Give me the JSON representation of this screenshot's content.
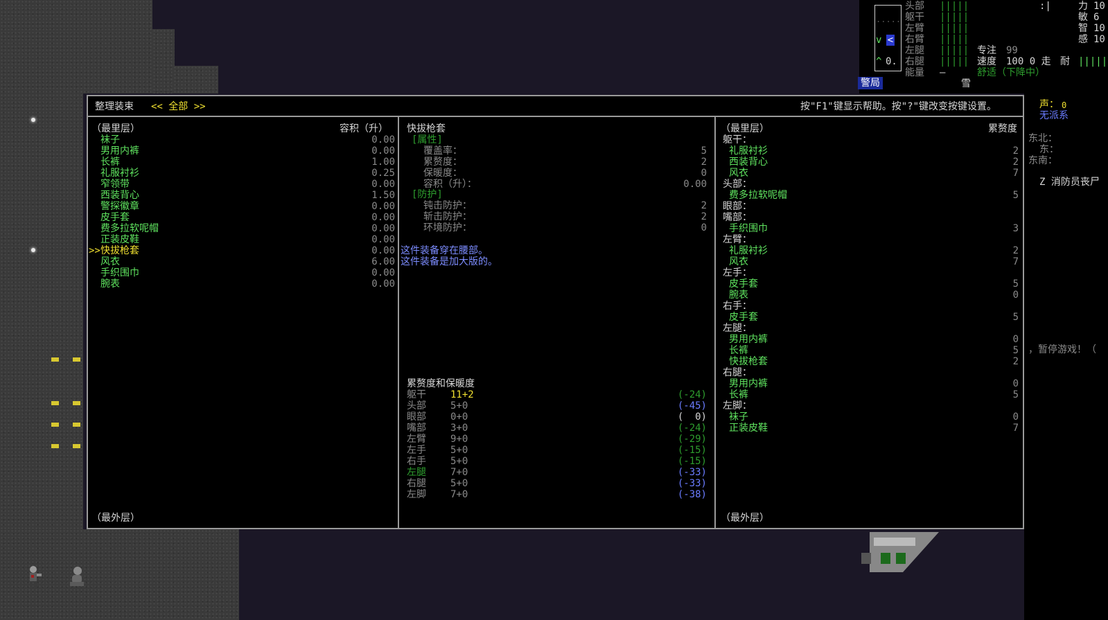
{
  "header": {
    "title": "整理装束",
    "filter": "<< 全部 >>",
    "help": "按\"F1\"键显示帮助。按\"?\"键改变按键设置。"
  },
  "left": {
    "innermost": "（最里层）",
    "outermost": "（最外层）",
    "vol_header": "容积（升）",
    "cursor": ">>",
    "items": [
      {
        "name": "袜子",
        "vol": "0.00"
      },
      {
        "name": "男用内裤",
        "vol": "0.00"
      },
      {
        "name": "长裤",
        "vol": "1.00"
      },
      {
        "name": "礼服衬衫",
        "vol": "0.25"
      },
      {
        "name": "窄领带",
        "vol": "0.00"
      },
      {
        "name": "西装背心",
        "vol": "1.50"
      },
      {
        "name": "警探徽章",
        "vol": "0.00"
      },
      {
        "name": "皮手套",
        "vol": "0.00"
      },
      {
        "name": "费多拉软呢帽",
        "vol": "0.00"
      },
      {
        "name": "正装皮鞋",
        "vol": "0.00"
      },
      {
        "name": "快拔枪套",
        "vol": "0.00"
      },
      {
        "name": "风衣",
        "vol": "6.00"
      },
      {
        "name": "手织围巾",
        "vol": "0.00"
      },
      {
        "name": "腕表",
        "vol": "0.00"
      }
    ]
  },
  "middle": {
    "item_name": "快拔枪套",
    "attr_header": "[属性]",
    "attrs": [
      {
        "label": "覆盖率：",
        "value": "5"
      },
      {
        "label": "累赘度：",
        "value": "2"
      },
      {
        "label": "保暖度：",
        "value": "0"
      },
      {
        "label": "容积（升）：",
        "value": "0.00"
      }
    ],
    "prot_header": "[防护]",
    "prots": [
      {
        "label": "钝击防护：",
        "value": "2"
      },
      {
        "label": "斩击防护：",
        "value": "2"
      },
      {
        "label": "环境防护：",
        "value": "0"
      }
    ],
    "notes": [
      "这件装备穿在腰部。",
      "这件装备是加大版的。"
    ],
    "enc_header": "累赘度和保暖度",
    "enc_rows": [
      {
        "part": "躯干",
        "enc": "11+2",
        "warm": "(-24)"
      },
      {
        "part": "头部",
        "enc": "5+0",
        "warm": "(-45)"
      },
      {
        "part": "眼部",
        "enc": "0+0",
        "warm": "(  0)"
      },
      {
        "part": "嘴部",
        "enc": "3+0",
        "warm": "(-24)"
      },
      {
        "part": "左臂",
        "enc": "9+0",
        "warm": "(-29)"
      },
      {
        "part": "左手",
        "enc": "5+0",
        "warm": "(-15)"
      },
      {
        "part": "右手",
        "enc": "5+0",
        "warm": "(-15)"
      },
      {
        "part": "左腿",
        "enc": "7+0",
        "warm": "(-33)"
      },
      {
        "part": "右腿",
        "enc": "5+0",
        "warm": "(-33)"
      },
      {
        "part": "左脚",
        "enc": "7+0",
        "warm": "(-38)"
      }
    ]
  },
  "right": {
    "innermost": "（最里层）",
    "outermost": "（最外层）",
    "enc_header": "累赘度",
    "groups": [
      {
        "part": "躯干：",
        "items": [
          {
            "name": "礼服衬衫",
            "v": "2"
          },
          {
            "name": "西装背心",
            "v": "2"
          },
          {
            "name": "风衣",
            "v": "7"
          }
        ]
      },
      {
        "part": "头部：",
        "items": [
          {
            "name": "费多拉软呢帽",
            "v": "5"
          }
        ]
      },
      {
        "part": "眼部：",
        "items": []
      },
      {
        "part": "嘴部：",
        "items": [
          {
            "name": "手织围巾",
            "v": "3"
          }
        ]
      },
      {
        "part": "左臂：",
        "items": [
          {
            "name": "礼服衬衫",
            "v": "2"
          },
          {
            "name": "风衣",
            "v": "7"
          }
        ]
      },
      {
        "part": "左手：",
        "items": [
          {
            "name": "皮手套",
            "v": "5"
          },
          {
            "name": "腕表",
            "v": "0"
          }
        ]
      },
      {
        "part": "右手：",
        "items": [
          {
            "name": "皮手套",
            "v": "5"
          }
        ]
      },
      {
        "part": "左腿：",
        "items": [
          {
            "name": "男用内裤",
            "v": "0"
          },
          {
            "name": "长裤",
            "v": "5"
          },
          {
            "name": "快拔枪套",
            "v": "2"
          }
        ]
      },
      {
        "part": "右腿：",
        "items": [
          {
            "name": "男用内裤",
            "v": "0"
          },
          {
            "name": "长裤",
            "v": "5"
          }
        ]
      },
      {
        "part": "左脚：",
        "items": [
          {
            "name": "袜子",
            "v": "0"
          },
          {
            "name": "正装皮鞋",
            "v": "7"
          }
        ]
      }
    ]
  },
  "hud": {
    "body_parts": [
      "头部",
      "躯干",
      "左臂",
      "右臂",
      "左腿",
      "右腿",
      "能量"
    ],
    "bars": [
      "|||||",
      "|||||",
      "|||||",
      "|||||",
      "|||||",
      "|||||",
      "—"
    ],
    "stats": [
      {
        "label": "力",
        "value": "10"
      },
      {
        "label": "敏",
        "value": "6"
      },
      {
        "label": "智",
        "value": "10"
      },
      {
        "label": "感",
        "value": "10"
      }
    ],
    "focus_label": "专注",
    "focus_value": "99",
    "speed_label": "速度",
    "speed_value": "100 0 走",
    "stamina_label": "耐",
    "stamina_bar": "|||||",
    "comfort": "舒适（下降中）",
    "weather": "雪",
    "location_tag": "警局",
    "cursor_mark": ":|",
    "minimap_glyphs": {
      "v": "v",
      "lt": "<",
      "caret": "^",
      "o": "0.",
      "dots": "....."
    }
  },
  "side": {
    "sound_label": "声：",
    "sound_value": "0",
    "faction": "无派系",
    "dirs": [
      "东北：",
      "东：",
      "东南："
    ],
    "log1": "Z 消防员丧尸",
    "log2": "，暂停游戏！（"
  }
}
